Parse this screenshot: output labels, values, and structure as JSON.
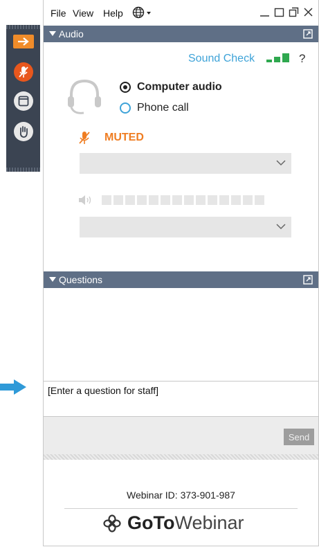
{
  "menu": {
    "file": "File",
    "view": "View",
    "help": "Help",
    "language_icon": "globe-icon",
    "window_controls": [
      "minimize-icon",
      "restore-icon",
      "popout-icon",
      "close-icon"
    ]
  },
  "rail": {
    "buttons": [
      "expand-arrow-icon",
      "mic-muted-icon",
      "window-icon",
      "raise-hand-icon"
    ]
  },
  "audio": {
    "title": "Audio",
    "sound_check": "Sound Check",
    "help": "?",
    "options": [
      {
        "label": "Computer audio",
        "selected": true
      },
      {
        "label": "Phone call",
        "selected": false
      }
    ],
    "muted_label": "MUTED",
    "mic_select_value": "",
    "speaker_select_value": ""
  },
  "questions": {
    "title": "Questions",
    "input_value": "[Enter a question for staff]",
    "send_label": "Send"
  },
  "footer": {
    "webinar_id": "Webinar ID: 373-901-987",
    "brand_go": "Go",
    "brand_to": "To",
    "brand_webinar": "Webinar"
  },
  "colors": {
    "section_bar": "#5f6f86",
    "accent_orange": "#ef7d22",
    "link_blue": "#3ea3d8",
    "signal_green": "#2fa84f",
    "arrow_blue": "#2f9ad8"
  }
}
